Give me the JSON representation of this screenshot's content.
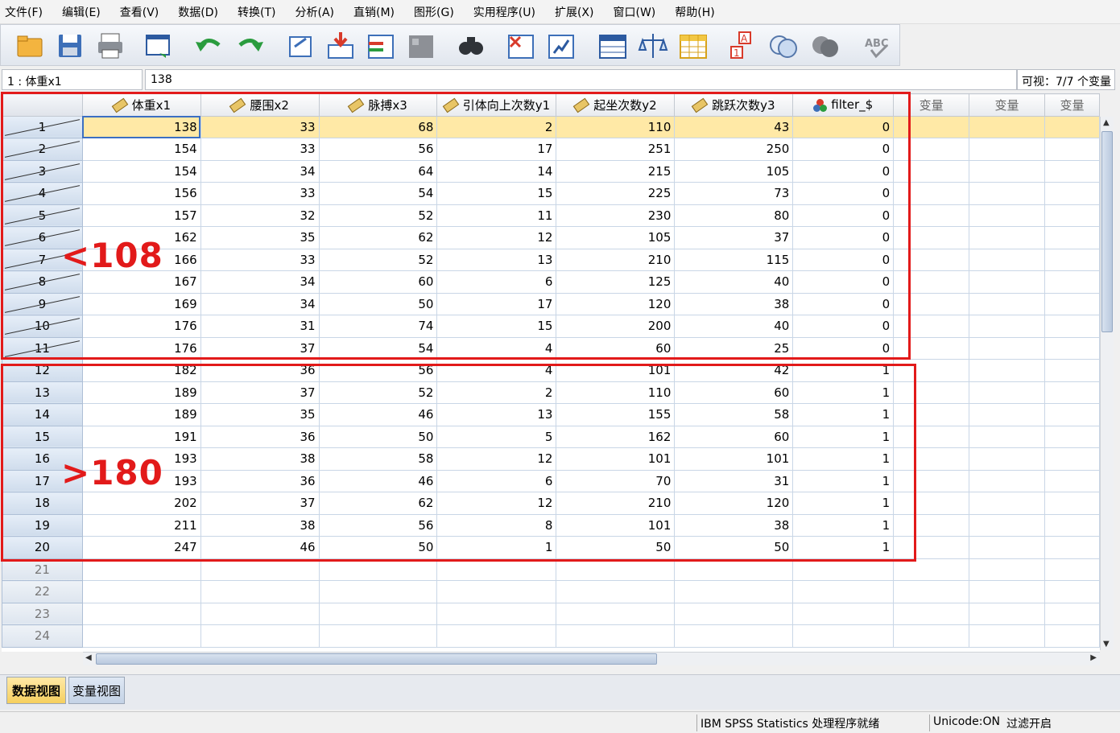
{
  "menu": [
    "文件(F)",
    "编辑(E)",
    "查看(V)",
    "数据(D)",
    "转换(T)",
    "分析(A)",
    "直销(M)",
    "图形(G)",
    "实用程序(U)",
    "扩展(X)",
    "窗口(W)",
    "帮助(H)"
  ],
  "toolbar_icons": [
    "open-folder-icon",
    "save-icon",
    "print-icon",
    "dialog-recall-icon",
    "undo-icon",
    "redo-icon",
    "goto-case-icon",
    "goto-variable-icon",
    "variables-icon",
    "run-descriptives-icon",
    "find-icon",
    "insert-cases-icon",
    "insert-variable-icon",
    "split-file-icon",
    "weight-cases-icon",
    "select-cases-icon",
    "value-labels-icon",
    "use-variable-sets-icon",
    "show-all-variables-icon",
    "spell-check-icon"
  ],
  "cellbar": {
    "ref": "1 : 体重x1",
    "value": "138",
    "visible_info": "可视：7/7 个变量"
  },
  "columns": [
    "体重x1",
    "腰围x2",
    "脉搏x3",
    "引体向上次数y1",
    "起坐次数y2",
    "跳跃次数y3",
    "filter_$"
  ],
  "empty_column_label": "变量",
  "rows": [
    {
      "n": "1",
      "v": [
        "138",
        "33",
        "68",
        "2",
        "110",
        "43",
        "0"
      ]
    },
    {
      "n": "2",
      "v": [
        "154",
        "33",
        "56",
        "17",
        "251",
        "250",
        "0"
      ]
    },
    {
      "n": "3",
      "v": [
        "154",
        "34",
        "64",
        "14",
        "215",
        "105",
        "0"
      ]
    },
    {
      "n": "4",
      "v": [
        "156",
        "33",
        "54",
        "15",
        "225",
        "73",
        "0"
      ]
    },
    {
      "n": "5",
      "v": [
        "157",
        "32",
        "52",
        "11",
        "230",
        "80",
        "0"
      ]
    },
    {
      "n": "6",
      "v": [
        "162",
        "35",
        "62",
        "12",
        "105",
        "37",
        "0"
      ]
    },
    {
      "n": "7",
      "v": [
        "166",
        "33",
        "52",
        "13",
        "210",
        "115",
        "0"
      ]
    },
    {
      "n": "8",
      "v": [
        "167",
        "34",
        "60",
        "6",
        "125",
        "40",
        "0"
      ]
    },
    {
      "n": "9",
      "v": [
        "169",
        "34",
        "50",
        "17",
        "120",
        "38",
        "0"
      ]
    },
    {
      "n": "10",
      "v": [
        "176",
        "31",
        "74",
        "15",
        "200",
        "40",
        "0"
      ]
    },
    {
      "n": "11",
      "v": [
        "176",
        "37",
        "54",
        "4",
        "60",
        "25",
        "0"
      ]
    },
    {
      "n": "12",
      "v": [
        "182",
        "36",
        "56",
        "4",
        "101",
        "42",
        "1"
      ]
    },
    {
      "n": "13",
      "v": [
        "189",
        "37",
        "52",
        "2",
        "110",
        "60",
        "1"
      ]
    },
    {
      "n": "14",
      "v": [
        "189",
        "35",
        "46",
        "13",
        "155",
        "58",
        "1"
      ]
    },
    {
      "n": "15",
      "v": [
        "191",
        "36",
        "50",
        "5",
        "162",
        "60",
        "1"
      ]
    },
    {
      "n": "16",
      "v": [
        "193",
        "38",
        "58",
        "12",
        "101",
        "101",
        "1"
      ]
    },
    {
      "n": "17",
      "v": [
        "193",
        "36",
        "46",
        "6",
        "70",
        "31",
        "1"
      ]
    },
    {
      "n": "18",
      "v": [
        "202",
        "37",
        "62",
        "12",
        "210",
        "120",
        "1"
      ]
    },
    {
      "n": "19",
      "v": [
        "211",
        "38",
        "56",
        "8",
        "101",
        "38",
        "1"
      ]
    },
    {
      "n": "20",
      "v": [
        "247",
        "46",
        "50",
        "1",
        "50",
        "50",
        "1"
      ]
    },
    {
      "n": "21",
      "v": [
        "",
        "",
        "",
        "",
        "",
        "",
        ""
      ]
    },
    {
      "n": "22",
      "v": [
        "",
        "",
        "",
        "",
        "",
        "",
        ""
      ]
    },
    {
      "n": "23",
      "v": [
        "",
        "",
        "",
        "",
        "",
        "",
        ""
      ]
    },
    {
      "n": "24",
      "v": [
        "",
        "",
        "",
        "",
        "",
        "",
        ""
      ]
    }
  ],
  "tabs": {
    "data_view": "数据视图",
    "variable_view": "变量视图"
  },
  "status": {
    "processor": "IBM SPSS Statistics 处理程序就绪",
    "unicode": "Unicode:ON",
    "filter": "过滤开启"
  },
  "annotations": {
    "upper": "<108",
    "lower": ">180"
  },
  "colors": {
    "annotation": "#e21a1a",
    "selected_row": "#ffe9a6",
    "active_tab": "#f5cf5f"
  }
}
